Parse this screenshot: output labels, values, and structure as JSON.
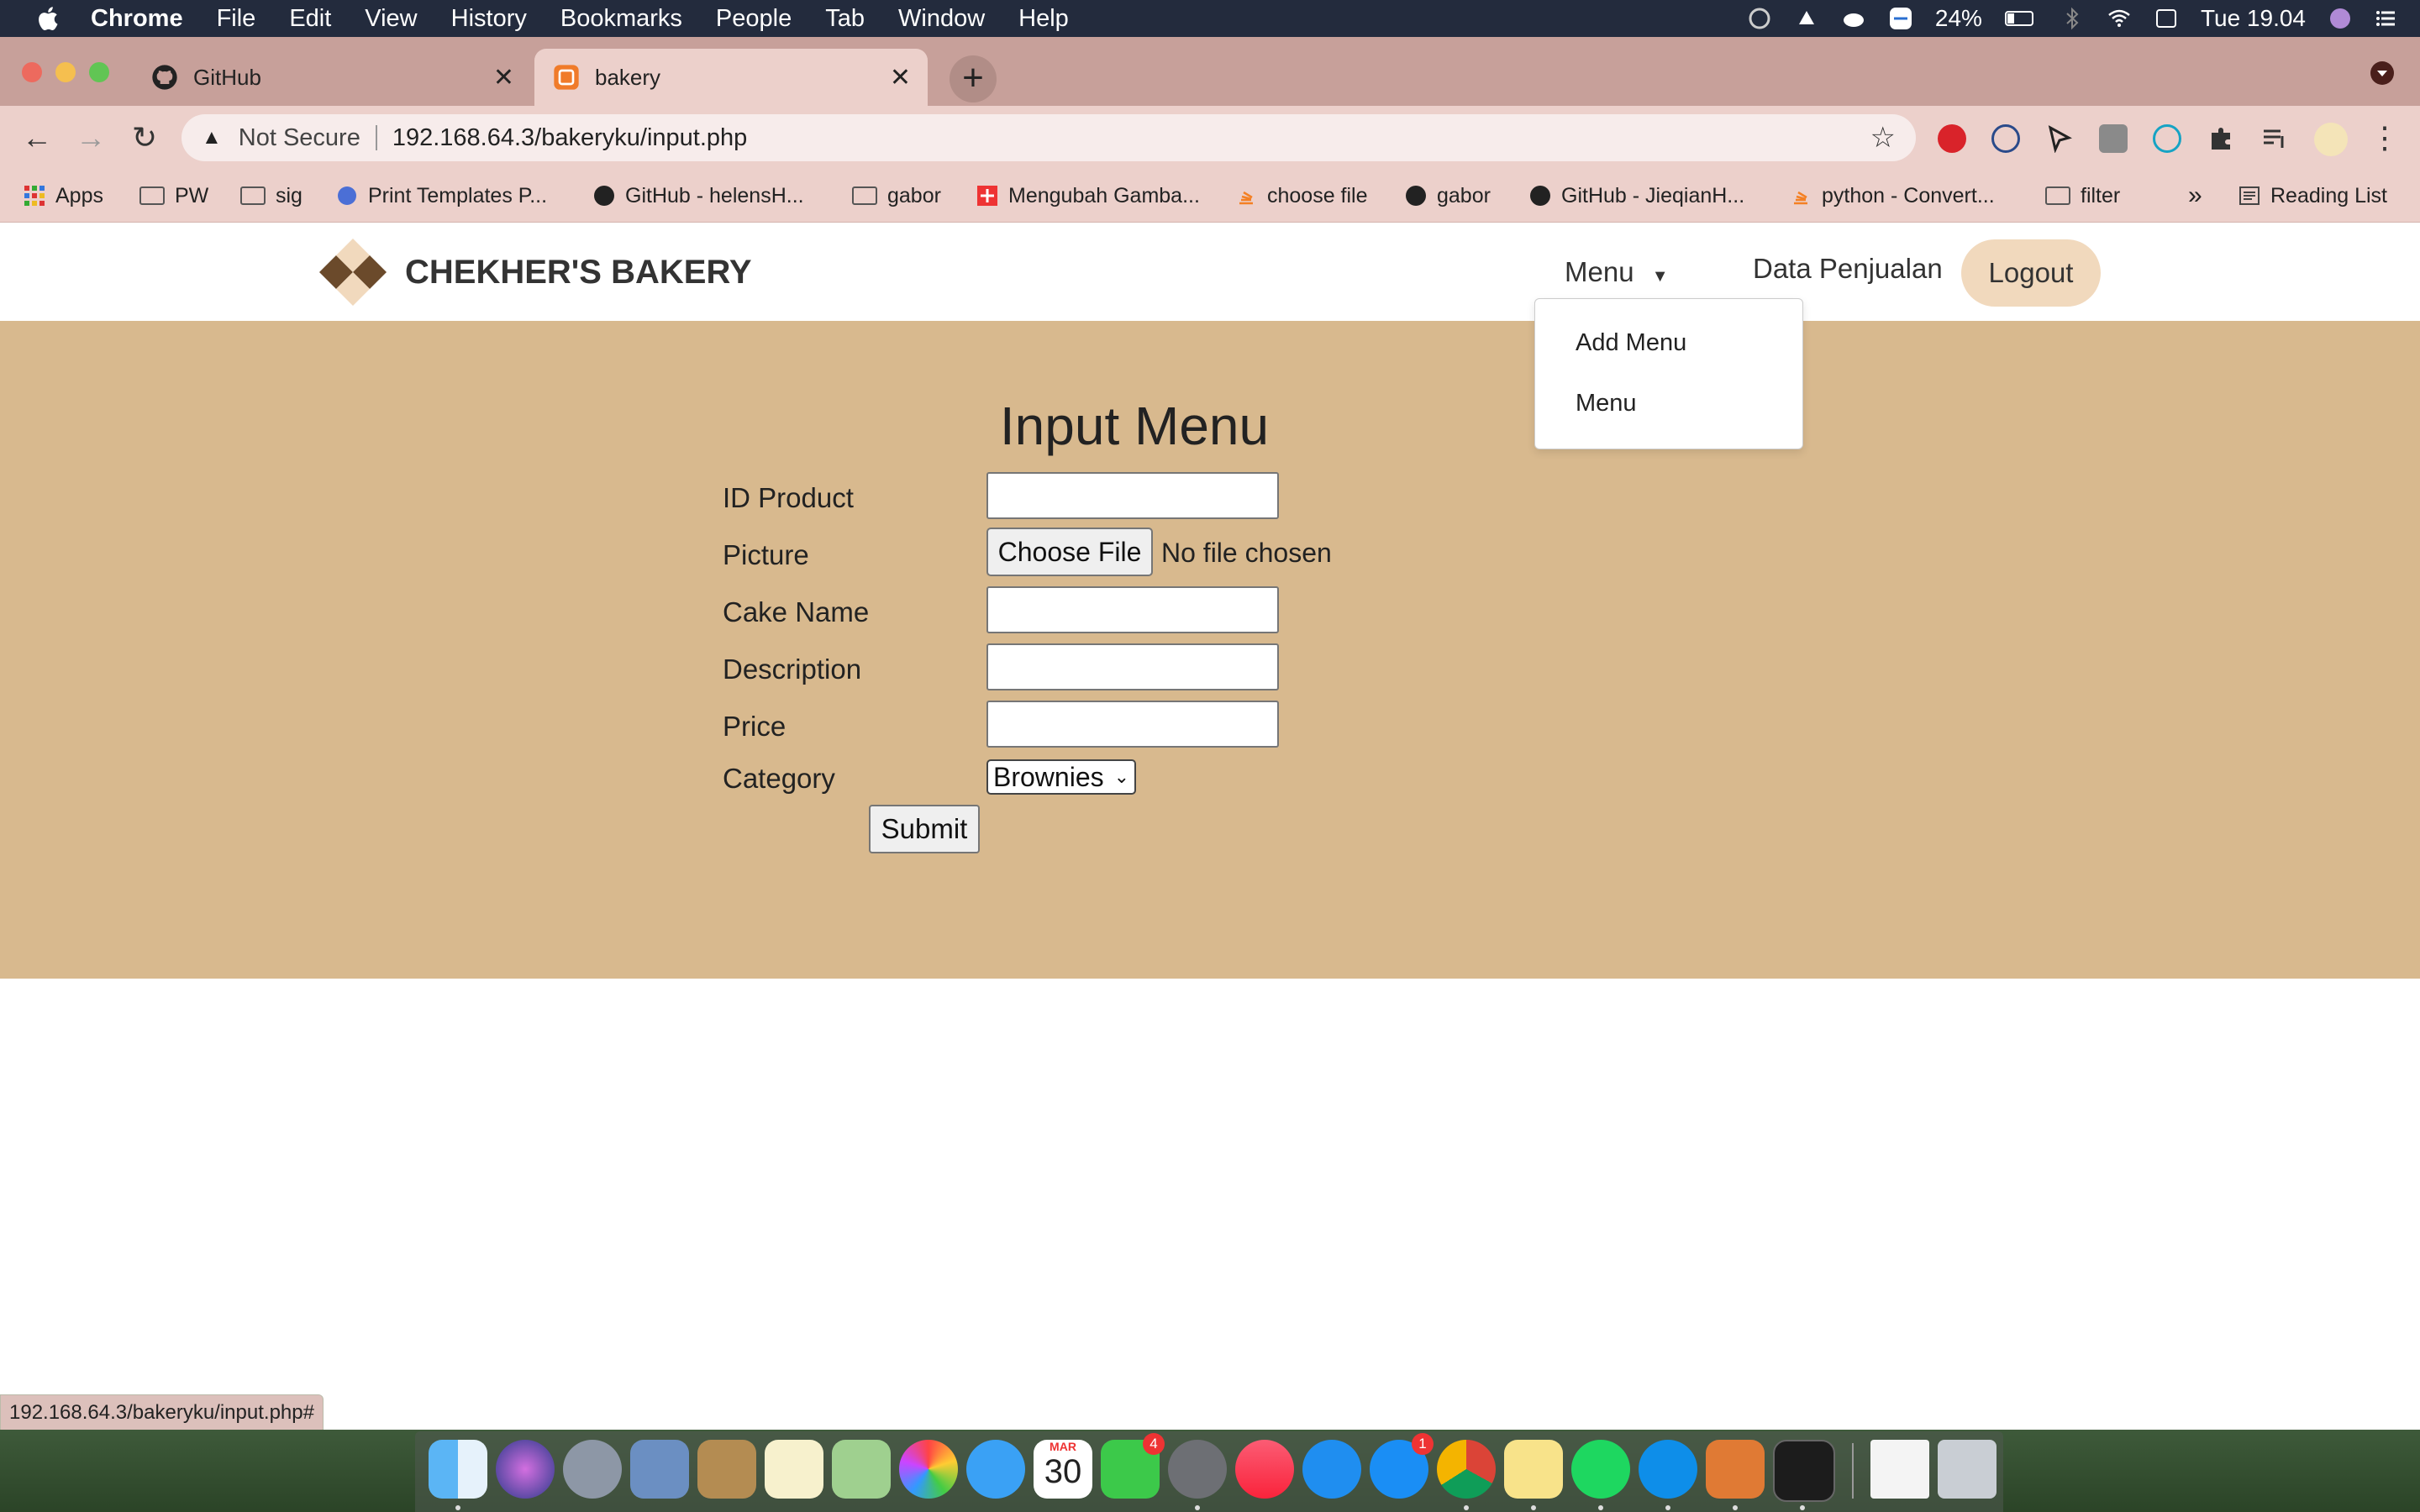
{
  "menubar": {
    "app_name": "Chrome",
    "items": [
      "File",
      "Edit",
      "View",
      "History",
      "Bookmarks",
      "People",
      "Tab",
      "Window",
      "Help"
    ],
    "battery": "24%",
    "clock": "Tue 19.04"
  },
  "tabs": [
    {
      "title": "GitHub",
      "icon": "github-icon"
    },
    {
      "title": "bakery",
      "icon": "xampp-icon"
    }
  ],
  "omnibox": {
    "security_label": "Not Secure",
    "url": "192.168.64.3/bakeryku/input.php"
  },
  "bookmarks": {
    "items": [
      {
        "label": "Apps",
        "icon": "apps-grid-icon"
      },
      {
        "label": "PW",
        "icon": "folder-icon"
      },
      {
        "label": "sig",
        "icon": "folder-icon"
      },
      {
        "label": "Print Templates P...",
        "icon": "site-icon"
      },
      {
        "label": "GitHub - helensH...",
        "icon": "github-icon"
      },
      {
        "label": "gabor",
        "icon": "folder-icon"
      },
      {
        "label": "Mengubah Gamba...",
        "icon": "site-icon"
      },
      {
        "label": "choose file",
        "icon": "stackoverflow-icon"
      },
      {
        "label": "gabor",
        "icon": "github-icon"
      },
      {
        "label": "GitHub - JieqianH...",
        "icon": "github-icon"
      },
      {
        "label": "python - Convert...",
        "icon": "stackoverflow-icon"
      },
      {
        "label": "filter",
        "icon": "folder-icon"
      }
    ],
    "overflow": "»",
    "reading_list": "Reading List"
  },
  "site": {
    "brand": "CHEKHER'S BAKERY",
    "nav_menu": "Menu",
    "nav_sales": "Data Penjualan",
    "logout": "Logout",
    "dropdown": [
      "Add Menu",
      "Menu"
    ],
    "accent": "#d8b98e"
  },
  "form": {
    "title": "Input Menu",
    "labels": {
      "id": "ID Product",
      "picture": "Picture",
      "name": "Cake Name",
      "description": "Description",
      "price": "Price",
      "category": "Category"
    },
    "choose_file": "Choose File",
    "no_file": "No file chosen",
    "category_value": "Brownies",
    "submit": "Submit"
  },
  "status_url": "192.168.64.3/bakeryku/input.php#",
  "dock": {
    "facetime_badge": "4",
    "appstore_badge": "1",
    "calendar_month": "MAR",
    "calendar_day": "30"
  }
}
